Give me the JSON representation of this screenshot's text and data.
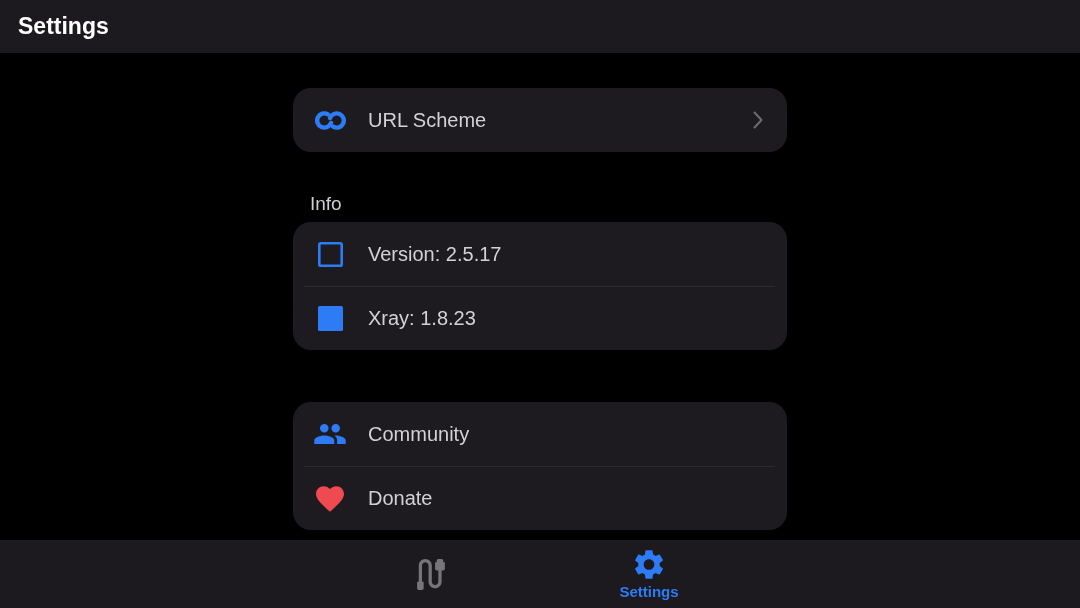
{
  "app_bar": {
    "title": "Settings"
  },
  "sections": [
    {
      "items": [
        {
          "label": "URL Scheme",
          "chevron": true
        }
      ]
    },
    {
      "header": "Info",
      "items": [
        {
          "label": "Version: 2.5.17"
        },
        {
          "label": "Xray: 1.8.23"
        }
      ]
    },
    {
      "items": [
        {
          "label": "Community"
        },
        {
          "label": "Donate"
        }
      ]
    }
  ],
  "bottom_nav": [
    {
      "selected": false
    },
    {
      "label": "Settings",
      "selected": true
    }
  ]
}
